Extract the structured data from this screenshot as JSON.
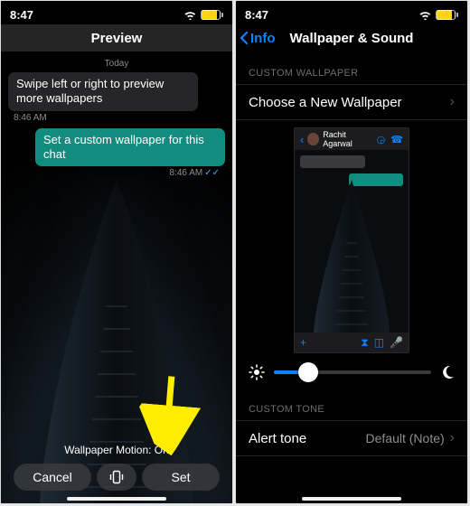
{
  "status": {
    "time": "8:47"
  },
  "left": {
    "title": "Preview",
    "today": "Today",
    "msg_in": "Swipe left or right to preview more wallpapers",
    "msg_in_time": "8:46 AM",
    "msg_out": "Set a custom wallpaper for this chat",
    "msg_out_time": "8:46 AM",
    "motion": "Wallpaper Motion: On",
    "cancel": "Cancel",
    "set": "Set"
  },
  "right": {
    "back": "Info",
    "title": "Wallpaper & Sound",
    "section_wp": "CUSTOM WALLPAPER",
    "choose": "Choose a New Wallpaper",
    "contact": "Rachit Agarwal",
    "section_tone": "CUSTOM TONE",
    "alert": "Alert tone",
    "alert_value": "Default (Note)"
  },
  "slider": {
    "value_pct": 22
  }
}
